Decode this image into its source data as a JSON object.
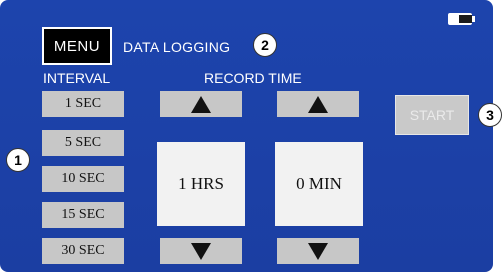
{
  "header": {
    "menu_label": "MENU",
    "title": "DATA LOGGING"
  },
  "callouts": {
    "one": "1",
    "two": "2",
    "three": "3"
  },
  "interval": {
    "label": "INTERVAL",
    "options": [
      "1 SEC",
      "5 SEC",
      "10 SEC",
      "15 SEC",
      "30 SEC"
    ]
  },
  "record_time": {
    "label": "RECORD TIME",
    "hours": "1 HRS",
    "minutes": "0 MIN"
  },
  "start_label": "START",
  "icons": {
    "up": "triangle-up-icon",
    "down": "triangle-down-icon",
    "battery": "battery-icon"
  },
  "colors": {
    "screen": "#1b3ea2",
    "button": "#c7c7c7",
    "value_box": "#f2f2f2"
  }
}
